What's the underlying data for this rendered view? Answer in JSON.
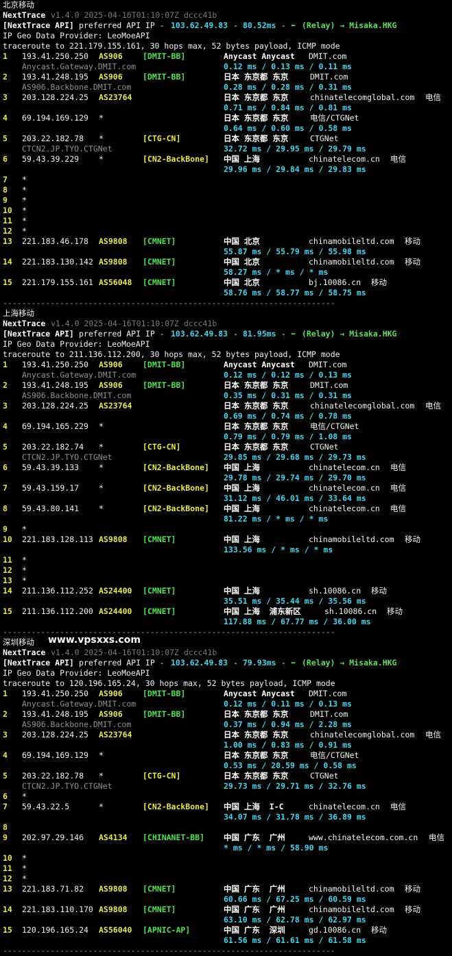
{
  "sections": [
    {
      "title": "北京移动",
      "watermark": "",
      "header": {
        "app": "NextTrace",
        "version": "v1.4.0 2025-04-16T01:10:07Z dccc41b",
        "api_tag": "[NextTrace API]",
        "api_text": "preferred API IP -",
        "api_ip": "103.62.49.83",
        "api_sep": "-",
        "api_ms": "80.52ms",
        "api_sep2": "-",
        "relay_icon": "⬅",
        "relay": "(Relay) → Misaka.HKG"
      },
      "geo": "IP Geo Data Provider: LeoMoeAPI",
      "traceroute": "traceroute to 221.179.155.161, 30 hops max, 52 bytes payload, ICMP mode",
      "hops": [
        {
          "n": "1",
          "ip": "193.41.250.250",
          "asn": "AS906",
          "tag": "[DMIT-BB]",
          "tagc": "gn",
          "geo": "Anycast Anycast",
          "dom": "DMIT.com",
          "isp": "",
          "rtt": "0.12 ms / 0.13 ms / 0.11 ms",
          "rdns": "Anycast.Gateway.DMIT.com"
        },
        {
          "n": "2",
          "ip": "193.41.248.195",
          "asn": "AS906",
          "tag": "[DMIT-BB]",
          "tagc": "gn",
          "geo": "日本 东京都 东京",
          "dom": "DMIT.com",
          "isp": "",
          "rtt": "0.28 ms / 0.28 ms / 0.31 ms",
          "rdns": "AS906.Backbone.DMIT.com"
        },
        {
          "n": "3",
          "ip": "203.128.224.25",
          "asn": "AS23764",
          "tag": "",
          "tagc": "gn",
          "geo": "日本 东京都 东京",
          "dom": "chinatelecomglobal.com",
          "isp": "电信",
          "rtt": "0.71 ms / 0.84 ms / 0.81 ms",
          "rdns": ""
        },
        {
          "n": "4",
          "ip": "69.194.169.129",
          "asn": "*",
          "tag": "",
          "tagc": "gn",
          "geo": "日本 东京都 东京",
          "dom": "电信/CTGNet",
          "isp": "",
          "rtt": "0.64 ms / 0.60 ms / 0.58 ms",
          "rdns": ""
        },
        {
          "n": "5",
          "ip": "203.22.182.78",
          "asn": "*",
          "tag": "[CTG-CN]",
          "tagc": "yl",
          "geo": "日本 东京都 东京",
          "dom": "CTGNet",
          "isp": "",
          "rtt": "32.72 ms / 29.95 ms / 29.79 ms",
          "rdns": "CTCN2.JP.TYO.CTGNet"
        },
        {
          "n": "6",
          "ip": "59.43.39.229",
          "asn": "*",
          "tag": "[CN2-BackBone]",
          "tagc": "yl",
          "geo": "中国 上海",
          "dom": "chinatelecom.cn",
          "isp": "电信",
          "rtt": "29.96 ms / 29.84 ms / 29.83 ms",
          "rdns": ""
        },
        {
          "n": "7",
          "star": "*"
        },
        {
          "n": "8",
          "star": "*"
        },
        {
          "n": "9",
          "star": "*"
        },
        {
          "n": "10",
          "star": "*"
        },
        {
          "n": "11",
          "star": "*"
        },
        {
          "n": "12",
          "star": "*"
        },
        {
          "n": "13",
          "ip": "221.183.46.178",
          "asn": "AS9808",
          "tag": "[CMNET]",
          "tagc": "gn",
          "geo": "中国 北京",
          "dom": "chinamobileltd.com",
          "isp": "移动",
          "rtt": "55.87 ms / 55.79 ms / 55.98 ms",
          "rdns": ""
        },
        {
          "n": "14",
          "ip": "221.183.130.142",
          "asn": "AS9808",
          "tag": "[CMNET]",
          "tagc": "gn",
          "geo": "中国 北京",
          "dom": "chinamobileltd.com",
          "isp": "移动",
          "rtt": "58.27 ms / * ms / * ms",
          "rdns": ""
        },
        {
          "n": "15",
          "ip": "221.179.155.161",
          "asn": "AS56048",
          "tag": "[CMNET]",
          "tagc": "gn",
          "geo": "中国 北京",
          "dom": "bj.10086.cn",
          "isp": "移动",
          "rtt": "58.76 ms / 58.77 ms / 58.75 ms",
          "rdns": ""
        }
      ]
    },
    {
      "title": "上海移动",
      "watermark": "",
      "header": {
        "app": "NextTrace",
        "version": "v1.4.0 2025-04-16T01:10:07Z dccc41b",
        "api_tag": "[NextTrace API]",
        "api_text": "preferred API IP -",
        "api_ip": "103.62.49.83",
        "api_sep": "-",
        "api_ms": "81.95ms",
        "api_sep2": "-",
        "relay_icon": "⬅",
        "relay": "(Relay) → Misaka.HKG"
      },
      "geo": "IP Geo Data Provider: LeoMoeAPI",
      "traceroute": "traceroute to 211.136.112.200, 30 hops max, 52 bytes payload, ICMP mode",
      "hops": [
        {
          "n": "1",
          "ip": "193.41.250.250",
          "asn": "AS906",
          "tag": "[DMIT-BB]",
          "tagc": "gn",
          "geo": "Anycast Anycast",
          "dom": "DMIT.com",
          "isp": "",
          "rtt": "0.12 ms / 0.12 ms / 0.13 ms",
          "rdns": "Anycast.Gateway.DMIT.com"
        },
        {
          "n": "2",
          "ip": "193.41.248.195",
          "asn": "AS906",
          "tag": "[DMIT-BB]",
          "tagc": "gn",
          "geo": "日本 东京都 东京",
          "dom": "DMIT.com",
          "isp": "",
          "rtt": "0.35 ms / 0.31 ms / 0.31 ms",
          "rdns": "AS906.Backbone.DMIT.com"
        },
        {
          "n": "3",
          "ip": "203.128.224.25",
          "asn": "AS23764",
          "tag": "",
          "tagc": "gn",
          "geo": "日本 东京都 东京",
          "dom": "chinatelecomglobal.com",
          "isp": "电信",
          "rtt": "0.69 ms / 0.74 ms / 0.78 ms",
          "rdns": ""
        },
        {
          "n": "4",
          "ip": "69.194.165.229",
          "asn": "*",
          "tag": "",
          "tagc": "gn",
          "geo": "日本 东京都 东京",
          "dom": "电信/CTGNet",
          "isp": "",
          "rtt": "0.79 ms / 0.79 ms / 1.08 ms",
          "rdns": ""
        },
        {
          "n": "5",
          "ip": "203.22.182.74",
          "asn": "*",
          "tag": "[CTG-CN]",
          "tagc": "yl",
          "geo": "日本 东京都 东京",
          "dom": "CTGNet",
          "isp": "",
          "rtt": "29.85 ms / 29.68 ms / 29.73 ms",
          "rdns": "CTCN2.JP.TYO.CTGNet"
        },
        {
          "n": "6",
          "ip": "59.43.39.133",
          "asn": "*",
          "tag": "[CN2-BackBone]",
          "tagc": "yl",
          "geo": "中国 上海",
          "dom": "chinatelecom.cn",
          "isp": "电信",
          "rtt": "29.78 ms / 29.74 ms / 29.70 ms",
          "rdns": ""
        },
        {
          "n": "7",
          "ip": "59.43.159.17",
          "asn": "*",
          "tag": "[CN2-BackBone]",
          "tagc": "yl",
          "geo": "中国 上海",
          "dom": "chinatelecom.cn",
          "isp": "电信",
          "rtt": "31.12 ms / 46.01 ms / 33.64 ms",
          "rdns": ""
        },
        {
          "n": "8",
          "ip": "59.43.80.141",
          "asn": "*",
          "tag": "[CN2-BackBone]",
          "tagc": "yl",
          "geo": "中国 上海",
          "dom": "chinatelecom.cn",
          "isp": "电信",
          "rtt": "81.22 ms / * ms / * ms",
          "rdns": ""
        },
        {
          "n": "9",
          "star": "*"
        },
        {
          "n": "10",
          "ip": "221.183.128.113",
          "asn": "AS9808",
          "tag": "[CMNET]",
          "tagc": "gn",
          "geo": "中国 上海",
          "dom": "chinamobileltd.com",
          "isp": "移动",
          "rtt": "133.56 ms / * ms / * ms",
          "rdns": ""
        },
        {
          "n": "11",
          "star": "*"
        },
        {
          "n": "12",
          "star": "*"
        },
        {
          "n": "13",
          "star": "*"
        },
        {
          "n": "14",
          "ip": "211.136.112.252",
          "asn": "AS24400",
          "tag": "[CMNET]",
          "tagc": "gn",
          "geo": "中国 上海",
          "dom": "sh.10086.cn",
          "isp": "移动",
          "rtt": "35.51 ms / 35.44 ms / 35.56 ms",
          "rdns": ""
        },
        {
          "n": "15",
          "ip": "211.136.112.200",
          "asn": "AS24400",
          "tag": "[CMNET]",
          "tagc": "gn",
          "geo": "中国 上海  浦东新区",
          "dom": "sh.10086.cn",
          "isp": "移动",
          "rtt": "117.88 ms / 67.77 ms / 36.00 ms",
          "rdns": ""
        }
      ]
    },
    {
      "title": "深圳移动",
      "watermark": "www.vpsxxs.com",
      "header": {
        "app": "NextTrace",
        "version": "v1.4.0 2025-04-16T01:10:07Z dccc41b",
        "api_tag": "[NextTrace API]",
        "api_text": "preferred API IP -",
        "api_ip": "103.62.49.83",
        "api_sep": "-",
        "api_ms": "79.93ms",
        "api_sep2": "-",
        "relay_icon": "⬅",
        "relay": "(Relay) → Misaka.HKG"
      },
      "geo": "IP Geo Data Provider: LeoMoeAPI",
      "traceroute": "traceroute to 120.196.165.24, 30 hops max, 52 bytes payload, ICMP mode",
      "hops": [
        {
          "n": "1",
          "ip": "193.41.250.250",
          "asn": "AS906",
          "tag": "[DMIT-BB]",
          "tagc": "gn",
          "geo": "Anycast Anycast",
          "dom": "DMIT.com",
          "isp": "",
          "rtt": "0.12 ms / 0.11 ms / 0.13 ms",
          "rdns": "Anycast.Gateway.DMIT.com"
        },
        {
          "n": "2",
          "ip": "193.41.248.195",
          "asn": "AS906",
          "tag": "[DMIT-BB]",
          "tagc": "gn",
          "geo": "日本 东京都 东京",
          "dom": "DMIT.com",
          "isp": "",
          "rtt": "0.37 ms / 0.94 ms / 2.28 ms",
          "rdns": "AS906.Backbone.DMIT.com"
        },
        {
          "n": "3",
          "ip": "203.128.224.25",
          "asn": "AS23764",
          "tag": "",
          "tagc": "gn",
          "geo": "日本 东京都 东京",
          "dom": "chinatelecomglobal.com",
          "isp": "电信",
          "rtt": "1.00 ms / 0.83 ms / 0.91 ms",
          "rdns": ""
        },
        {
          "n": "4",
          "ip": "69.194.169.129",
          "asn": "*",
          "tag": "",
          "tagc": "gn",
          "geo": "日本 东京都 东京",
          "dom": "电信/CTGNet",
          "isp": "",
          "rtt": "0.53 ms / 20.59 ms / 0.58 ms",
          "rdns": ""
        },
        {
          "n": "5",
          "ip": "203.22.182.78",
          "asn": "*",
          "tag": "[CTG-CN]",
          "tagc": "yl",
          "geo": "日本 东京都 东京",
          "dom": "CTGNet",
          "isp": "",
          "rtt": "29.73 ms / 29.71 ms / 32.76 ms",
          "rdns": "CTCN2.JP.TYO.CTGNet"
        },
        {
          "n": "6",
          "star": "*"
        },
        {
          "n": "7",
          "ip": "59.43.22.5",
          "asn": "*",
          "tag": "[CN2-BackBone]",
          "tagc": "yl",
          "geo": "中国 上海  I-C",
          "dom": "chinatelecom.cn",
          "isp": "电信",
          "rtt": "34.07 ms / 31.78 ms / 36.89 ms",
          "rdns": ""
        },
        {
          "n": "8",
          "star": ""
        },
        {
          "n": "9",
          "ip": "202.97.29.146",
          "asn": "AS4134",
          "tag": "[CHINANET-BB]",
          "tagc": "gn",
          "geo": "中国 广东  广州",
          "dom": "www.chinatelecom.com.cn",
          "isp": "电信",
          "rtt": "* ms / * ms / 58.90 ms",
          "rdns": ""
        },
        {
          "n": "10",
          "star": "*"
        },
        {
          "n": "11",
          "star": "*"
        },
        {
          "n": "12",
          "star": "*"
        },
        {
          "n": "13",
          "ip": "221.183.71.82",
          "asn": "AS9808",
          "tag": "[CMNET]",
          "tagc": "gn",
          "geo": "中国 广东  广州",
          "dom": "chinamobileltd.com",
          "isp": "移动",
          "rtt": "60.66 ms / 67.25 ms / 60.59 ms",
          "rdns": ""
        },
        {
          "n": "14",
          "ip": "221.183.110.170",
          "asn": "AS9808",
          "tag": "[CMNET]",
          "tagc": "gn",
          "geo": "中国 广东  广州",
          "dom": "chinamobileltd.com",
          "isp": "移动",
          "rtt": "63.10 ms / 62.78 ms / 62.97 ms",
          "rdns": ""
        },
        {
          "n": "15",
          "ip": "120.196.165.24",
          "asn": "AS56040",
          "tag": "[APNIC-AP]",
          "tagc": "gn",
          "geo": "中国 广东  深圳",
          "dom": "gd.10086.cn",
          "isp": "移动",
          "rtt": "61.56 ms / 61.61 ms / 61.58 ms",
          "rdns": ""
        }
      ]
    }
  ],
  "separator": "----------------------------------------------------------------------"
}
